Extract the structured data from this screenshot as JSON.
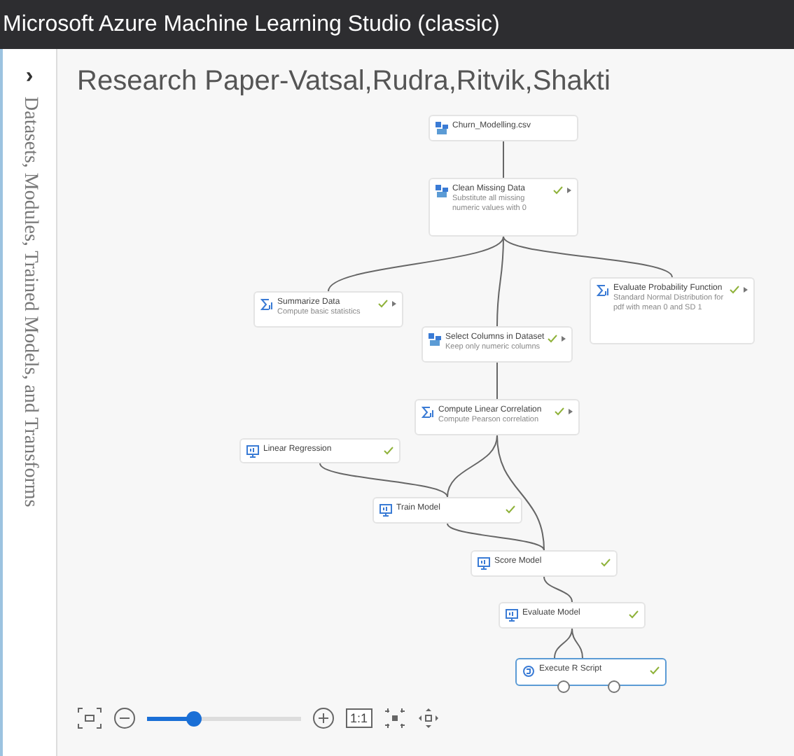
{
  "window": {
    "title": "Microsoft Azure Machine Learning Studio (classic)"
  },
  "sidebar": {
    "toggle": "›",
    "label": "Datasets, Modules, Trained Models, and Transforms"
  },
  "experiment": {
    "title": "Research Paper-Vatsal,Rudra,Ritvik,Shakti"
  },
  "nodes": [
    {
      "kind": "dataset",
      "name": "Churn_Modelling.csv",
      "done": false,
      "menu": false,
      "selected": false
    },
    {
      "kind": "dataset",
      "name": "Clean Missing Data",
      "description": "Substitute all missing numeric values with 0",
      "done": true,
      "menu": true,
      "selected": false
    },
    {
      "kind": "stats",
      "name": "Summarize Data",
      "description": "Compute basic statistics",
      "done": true,
      "menu": true,
      "selected": false
    },
    {
      "kind": "dataset",
      "name": "Select Columns in Dataset",
      "description": "Keep only numeric columns",
      "done": true,
      "menu": true,
      "selected": false
    },
    {
      "kind": "stats",
      "name": "Evaluate Probability Function",
      "description": "Standard Normal Distribution for pdf with mean 0 and SD 1",
      "done": true,
      "menu": true,
      "selected": false
    },
    {
      "kind": "stats",
      "name": "Compute Linear Correlation",
      "description": "Compute Pearson correlation",
      "done": true,
      "menu": true,
      "selected": false
    },
    {
      "kind": "model",
      "name": "Linear Regression",
      "done": true,
      "menu": false,
      "selected": false
    },
    {
      "kind": "model",
      "name": "Train Model",
      "done": true,
      "menu": false,
      "selected": false
    },
    {
      "kind": "model",
      "name": "Score Model",
      "done": true,
      "menu": false,
      "selected": false
    },
    {
      "kind": "model",
      "name": "Evaluate Model",
      "done": true,
      "menu": false,
      "selected": false
    },
    {
      "kind": "script",
      "name": "Execute R Script",
      "done": true,
      "menu": false,
      "selected": true
    }
  ],
  "zoom": {
    "level": 0.3,
    "one_to_one": "1:1"
  }
}
